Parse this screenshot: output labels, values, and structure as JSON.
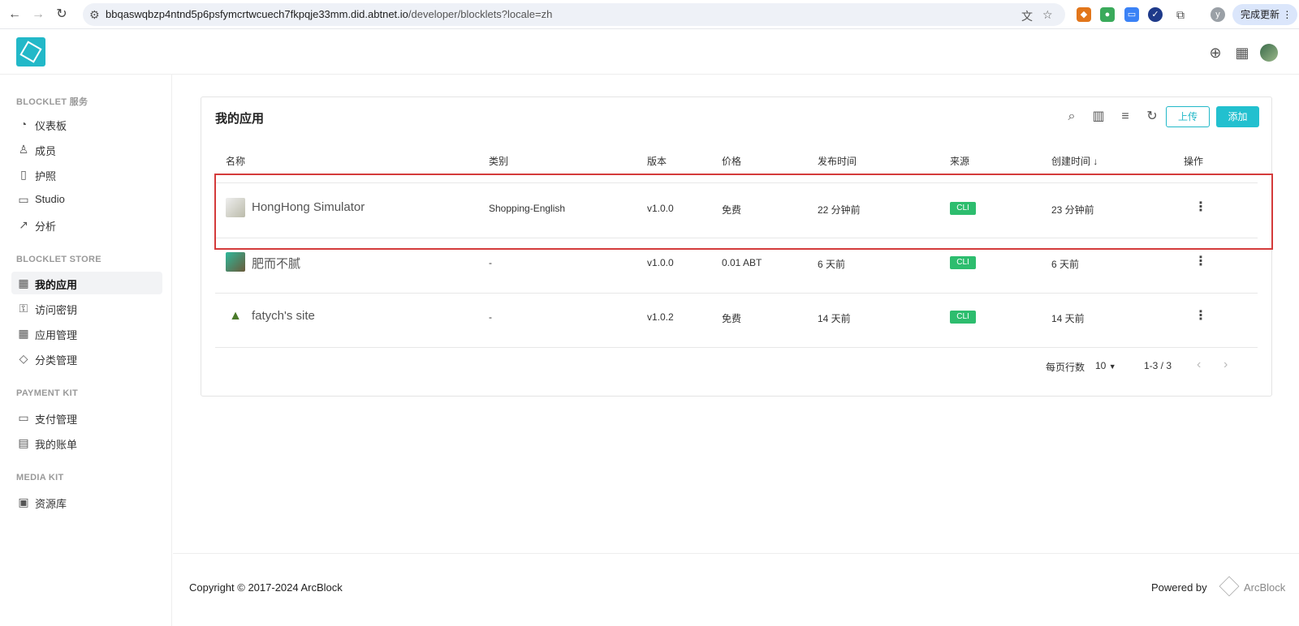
{
  "browser": {
    "url_host": "bbqaswqbzp4ntnd5p6psfymcrtwcuech7fkpqje33mm.did.abtnet.io",
    "url_path": "/developer/blocklets?locale=zh",
    "profile_letter": "y",
    "update_label": "完成更新"
  },
  "sidebar": {
    "sections": [
      {
        "title": "BLOCKLET 服务",
        "items": [
          {
            "label": "仪表板",
            "icon": "dashboard-icon"
          },
          {
            "label": "成员",
            "icon": "user-icon"
          },
          {
            "label": "护照",
            "icon": "passport-icon"
          },
          {
            "label": "Studio",
            "icon": "studio-icon"
          },
          {
            "label": "分析",
            "icon": "chart-icon"
          }
        ]
      },
      {
        "title": "BLOCKLET STORE",
        "items": [
          {
            "label": "我的应用",
            "icon": "grid-icon",
            "active": true
          },
          {
            "label": "访问密钥",
            "icon": "key-icon"
          },
          {
            "label": "应用管理",
            "icon": "apps-icon"
          },
          {
            "label": "分类管理",
            "icon": "tag-icon"
          }
        ]
      },
      {
        "title": "PAYMENT KIT",
        "items": [
          {
            "label": "支付管理",
            "icon": "card-icon"
          },
          {
            "label": "我的账单",
            "icon": "bill-icon"
          }
        ]
      },
      {
        "title": "MEDIA KIT",
        "items": [
          {
            "label": "资源库",
            "icon": "gallery-icon"
          }
        ]
      }
    ]
  },
  "main": {
    "title": "我的应用",
    "upload_label": "上传",
    "add_label": "添加",
    "columns": [
      "名称",
      "类别",
      "版本",
      "价格",
      "发布时间",
      "来源",
      "创建时间",
      "操作"
    ],
    "sort_indicator": "↓",
    "rows": [
      {
        "name": "HongHong Simulator",
        "category": "Shopping-English",
        "version": "v1.0.0",
        "price": "免费",
        "published": "22 分钟前",
        "source": "CLI",
        "created": "23 分钟前"
      },
      {
        "name": "肥而不腻",
        "category": "-",
        "version": "v1.0.0",
        "price": "0.01 ABT",
        "published": "6 天前",
        "source": "CLI",
        "created": "6 天前"
      },
      {
        "name": "fatych's site",
        "category": "-",
        "version": "v1.0.2",
        "price": "免费",
        "published": "14 天前",
        "source": "CLI",
        "created": "14 天前"
      }
    ],
    "pagination": {
      "rows_per_page_label": "每页行数",
      "rows_per_page": "10",
      "range": "1-3 / 3"
    }
  },
  "footer": {
    "copyright": "Copyright © 2017-2024  ArcBlock",
    "powered_by": "Powered by",
    "brand": "ArcBlock"
  },
  "colors": {
    "accent": "#22c0cf",
    "cli_badge": "#2dbd6e",
    "highlight": "#d43b3b"
  }
}
